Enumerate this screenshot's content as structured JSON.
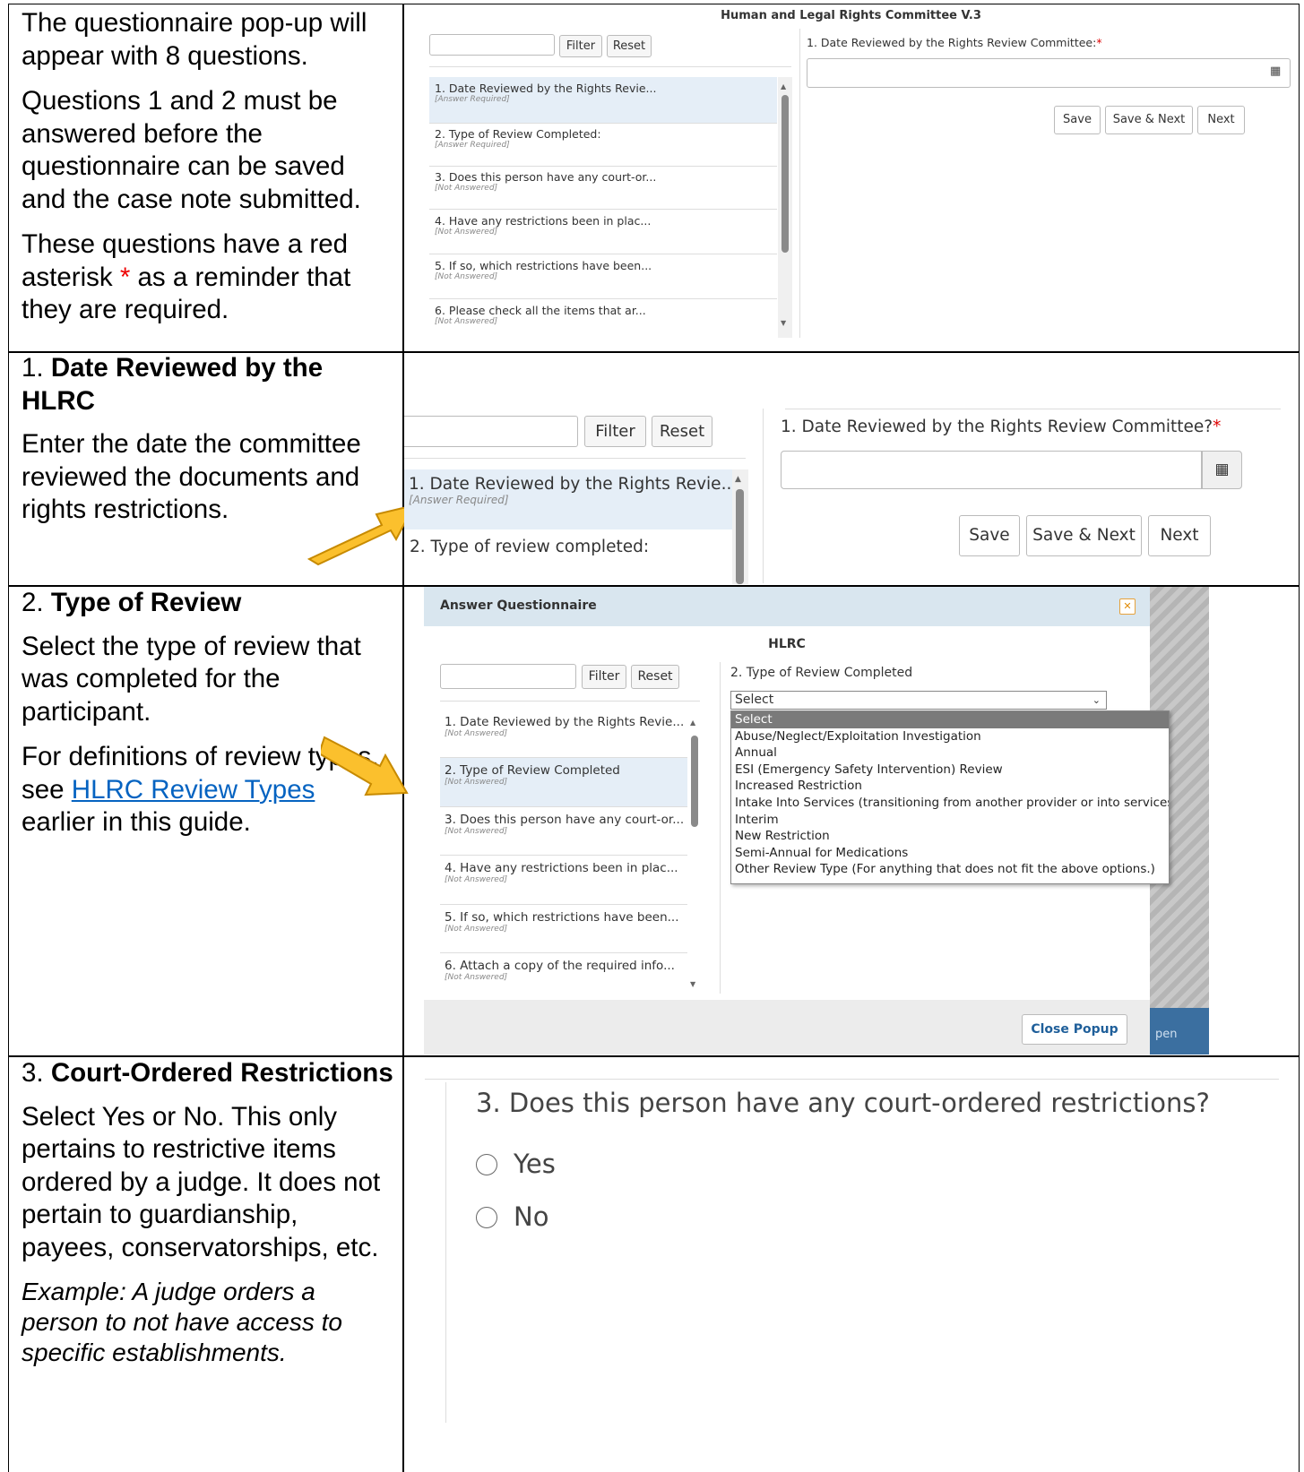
{
  "row1": {
    "p1": "The questionnaire pop-up will appear with 8 questions.",
    "p2": "Questions 1 and 2 must be answered before the questionnaire can be saved and the case note submitted.",
    "p3_a": "These questions have a red asterisk ",
    "p3_star": "*",
    "p3_b": " as a reminder that they are required."
  },
  "shot1": {
    "title": "Human and Legal Rights Committee V.3",
    "filter": "Filter",
    "reset": "Reset",
    "question": "1. Date Reviewed by the Rights Review Committee:",
    "star": "*",
    "save": "Save",
    "save_next": "Save & Next",
    "next": "Next",
    "items": [
      {
        "label": "1. Date Reviewed by the Rights Revie...",
        "status": "[Answer Required]"
      },
      {
        "label": "2. Type of Review Completed:",
        "status": "[Answer Required]"
      },
      {
        "label": "3. Does this person have any court-or...",
        "status": "[Not Answered]"
      },
      {
        "label": "4. Have any restrictions been in plac...",
        "status": "[Not Answered]"
      },
      {
        "label": "5. If so, which restrictions have been...",
        "status": "[Not Answered]"
      },
      {
        "label": "6. Please check all the items that ar...",
        "status": "[Not Answered]"
      }
    ]
  },
  "row2": {
    "num": "1. ",
    "heading": "Date Reviewed by the HLRC",
    "p": "Enter the date the committee reviewed the documents and rights restrictions."
  },
  "shot2": {
    "filter": "Filter",
    "reset": "Reset",
    "question": "1. Date Reviewed by the Rights Review Committee?",
    "star": "*",
    "save": "Save",
    "save_next": "Save & Next",
    "next": "Next",
    "item1": "1. Date Reviewed by the Rights Revie...",
    "item1_status": "[Answer Required]",
    "item2": "2. Type of review completed:"
  },
  "row3": {
    "num": "2. ",
    "heading": "Type of Review",
    "p1": "Select the type of review that was completed for the participant.",
    "p2_a": "For definitions of review types, see ",
    "p2_link": "HLRC Review Types",
    "p2_b": " earlier in this guide."
  },
  "shot3": {
    "header": "Answer Questionnaire",
    "close_x": "✕",
    "title": "HLRC",
    "filter": "Filter",
    "reset": "Reset",
    "question": "2. Type of Review Completed",
    "select_value": "Select",
    "options": [
      "Select",
      "Abuse/Neglect/Exploitation Investigation",
      "Annual",
      "ESI (Emergency Safety Intervention) Review",
      "Increased Restriction",
      "Intake Into Services (transitioning from another provider or into services)",
      "Interim",
      "New Restriction",
      "Semi-Annual for Medications",
      "Other Review Type (For anything that does not fit the above options.)"
    ],
    "items": [
      {
        "label": "1. Date Reviewed by the Rights Revie...",
        "status": "[Not Answered]"
      },
      {
        "label": "2. Type of Review Completed",
        "status": "[Not Answered]"
      },
      {
        "label": "3. Does this person have any court-or...",
        "status": "[Not Answered]"
      },
      {
        "label": "4. Have any restrictions been in plac...",
        "status": "[Not Answered]"
      },
      {
        "label": "5. If so, which restrictions have been...",
        "status": "[Not Answered]"
      },
      {
        "label": "6. Attach a copy of the required info...",
        "status": "[Not Answered]"
      }
    ],
    "close_popup": "Close Popup",
    "behind_btn": "pen"
  },
  "row4": {
    "num": "3. ",
    "heading": "Court-Ordered Restrictions",
    "p1": "Select Yes or No. This only pertains to restrictive items ordered by a judge. It does not pertain to guardianship, payees, conservatorships, etc.",
    "p2": "Example: A judge orders a person to not have access to specific establishments."
  },
  "shot4": {
    "question": "3. Does this person have any court-ordered restrictions?",
    "yes": "Yes",
    "no": "No"
  }
}
